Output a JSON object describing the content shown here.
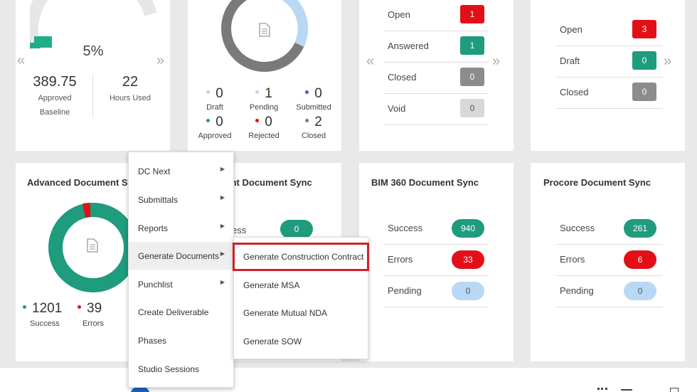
{
  "budget": {
    "percent": "5%",
    "approved_value": "389.75",
    "approved_label_1": "Approved",
    "approved_label_2": "Baseline",
    "hours_value": "22",
    "hours_label": "Hours Used",
    "gauge_fraction": 0.05
  },
  "status_donut": {
    "stats": [
      {
        "value": "0",
        "label": "Draft",
        "color": "#cfcfcf"
      },
      {
        "value": "1",
        "label": "Pending",
        "color": "#b8d8f5"
      },
      {
        "value": "0",
        "label": "Submitted",
        "color": "#7b3fc4"
      },
      {
        "value": "0",
        "label": "Approved",
        "color": "#1f9b7e"
      },
      {
        "value": "0",
        "label": "Rejected",
        "color": "#e30f17"
      },
      {
        "value": "2",
        "label": "Closed",
        "color": "#7a7a7a"
      }
    ]
  },
  "rfi_card": {
    "rows": [
      {
        "label": "Open",
        "count": "1"
      },
      {
        "label": "Answered",
        "count": "1"
      },
      {
        "label": "Closed",
        "count": "0"
      },
      {
        "label": "Void",
        "count": "0"
      }
    ]
  },
  "issues_card": {
    "rows": [
      {
        "label": "Open",
        "count": "3"
      },
      {
        "label": "Draft",
        "count": "0"
      },
      {
        "label": "Closed",
        "count": "0"
      }
    ]
  },
  "advanced_sync": {
    "title": "Advanced Document Sy",
    "success_value": "1201",
    "success_label": "Success",
    "errors_value": "39",
    "errors_label": "Errors"
  },
  "sharepoint_sync": {
    "title": "int Document Sync",
    "row_label": "ess",
    "row_value": "0"
  },
  "bim360_sync": {
    "title": "BIM 360 Document Sync",
    "rows": [
      {
        "label": "Success",
        "value": "940"
      },
      {
        "label": "Errors",
        "value": "33"
      },
      {
        "label": "Pending",
        "value": "0"
      }
    ]
  },
  "procore_sync": {
    "title": "Procore Document Sync",
    "rows": [
      {
        "label": "Success",
        "value": "261"
      },
      {
        "label": "Errors",
        "value": "6"
      },
      {
        "label": "Pending",
        "value": "0"
      }
    ]
  },
  "context_menu": {
    "items": [
      {
        "label": "DC Next"
      },
      {
        "label": "Submittals"
      },
      {
        "label": "Reports"
      },
      {
        "label": "Generate Documents"
      },
      {
        "label": "Punchlist"
      },
      {
        "label": "Create Deliverable"
      },
      {
        "label": "Phases"
      },
      {
        "label": "Studio Sessions"
      }
    ]
  },
  "submenu": {
    "items": [
      {
        "label": "Generate Construction Contract"
      },
      {
        "label": "Generate MSA"
      },
      {
        "label": "Generate Mutual NDA"
      },
      {
        "label": "Generate SOW"
      }
    ]
  },
  "colors": {
    "accent_green": "#1f9b7e",
    "error_red": "#e30f17",
    "highlight_border": "#d0202a"
  }
}
